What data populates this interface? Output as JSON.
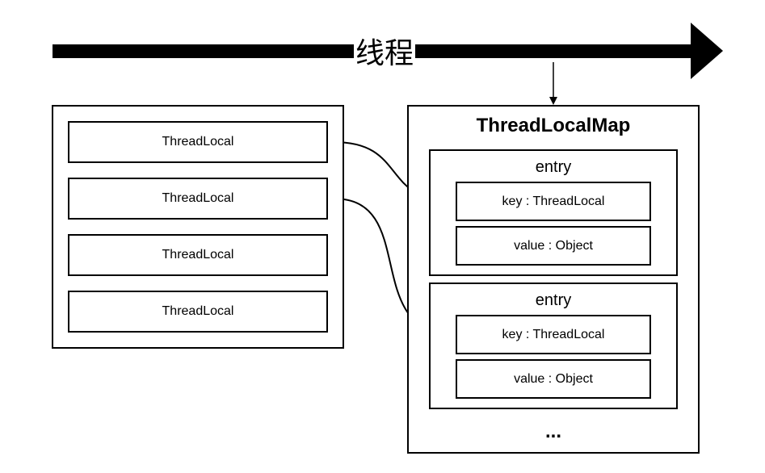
{
  "thread": {
    "label": "线程"
  },
  "threadlocal_list": {
    "items": [
      "ThreadLocal",
      "ThreadLocal",
      "ThreadLocal",
      "ThreadLocal"
    ]
  },
  "map": {
    "title": "ThreadLocalMap",
    "entries": [
      {
        "title": "entry",
        "key": "key : ThreadLocal",
        "value": "value : Object"
      },
      {
        "title": "entry",
        "key": "key : ThreadLocal",
        "value": "value : Object"
      }
    ],
    "more": "..."
  }
}
